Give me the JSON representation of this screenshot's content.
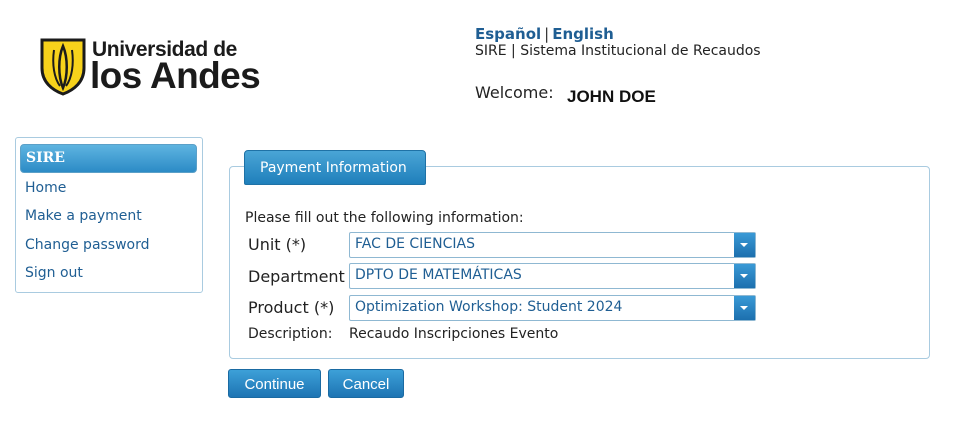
{
  "brand": {
    "line1": "Universidad de",
    "line2": "los Andes",
    "shield_color": "#f7d21b"
  },
  "header": {
    "lang_es": "Español",
    "lang_sep": "|",
    "lang_en": "English",
    "subtitle": "SIRE | Sistema Institucional de Recaudos",
    "welcome_label": "Welcome:",
    "user_name": "JOHN DOE"
  },
  "sidebar": {
    "title": "SIRE",
    "items": [
      {
        "label": "Home"
      },
      {
        "label": "Make a payment"
      },
      {
        "label": "Change password"
      },
      {
        "label": "Sign out"
      }
    ]
  },
  "form": {
    "legend": "Payment Information",
    "instructions": "Please fill out the following information:",
    "fields": [
      {
        "label": "Unit (*)",
        "value": "FAC DE CIENCIAS"
      },
      {
        "label": "Department",
        "value": "DPTO DE MATEMÁTICAS"
      },
      {
        "label": "Product (*)",
        "value": "Optimization Workshop: Student 2024"
      }
    ],
    "description_label": "Description:",
    "description_value": "Recaudo Inscripciones Evento"
  },
  "buttons": {
    "continue": "Continue",
    "cancel": "Cancel"
  },
  "colors": {
    "accent": "#2c8bc6",
    "link": "#1f5e93",
    "border": "#a9cbe0"
  }
}
